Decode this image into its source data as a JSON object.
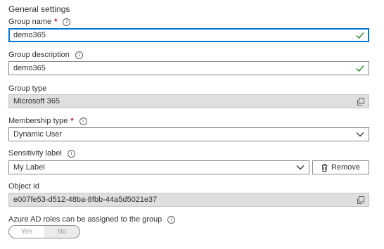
{
  "section": {
    "title": "General settings"
  },
  "group_name": {
    "label": "Group name",
    "required": "*",
    "value": "demo365"
  },
  "group_description": {
    "label": "Group description",
    "value": "demo365"
  },
  "group_type": {
    "label": "Group type",
    "value": "Microsoft 365"
  },
  "membership_type": {
    "label": "Membership type",
    "required": "*",
    "value": "Dynamic User"
  },
  "sensitivity_label": {
    "label": "Sensitivity label",
    "value": "My Label",
    "remove_label": "Remove"
  },
  "object_id": {
    "label": "Object Id",
    "value": "e007fe53-d512-48ba-8fbb-44a5d5021e37"
  },
  "azure_roles": {
    "label": "Azure AD roles can be assigned to the group",
    "options": [
      "Yes",
      "No"
    ],
    "selected": "No"
  },
  "icons": {
    "info": "info-icon",
    "valid": "checkmark-icon",
    "copy": "copy-icon",
    "dropdown": "chevron-down-icon",
    "delete": "trash-icon"
  },
  "colors": {
    "accent": "#0078d4",
    "valid": "#107c10",
    "required": "#a4262c",
    "disabled_bg": "#e1dfdd"
  }
}
